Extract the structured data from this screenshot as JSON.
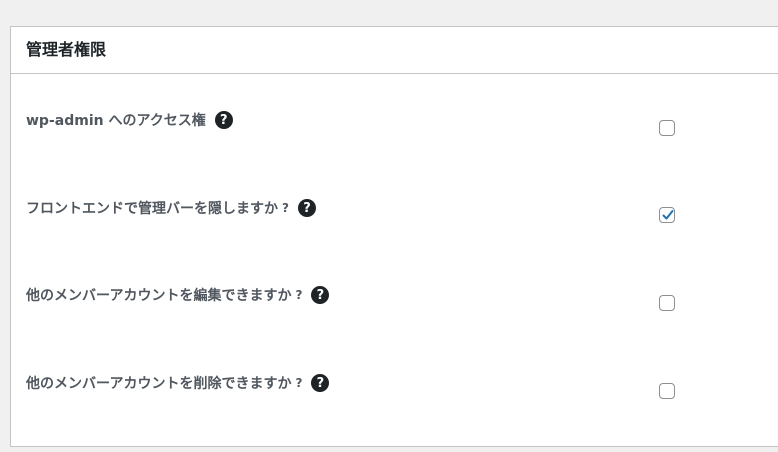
{
  "panel": {
    "title": "管理者権限"
  },
  "rows": [
    {
      "label": "wp-admin へのアクセス権",
      "question_mark": "",
      "help_icon": "?",
      "checked": false
    },
    {
      "label": "フロントエンドで管理バーを隠しますか",
      "question_mark": "?",
      "help_icon": "?",
      "checked": true
    },
    {
      "label": "他のメンバーアカウントを編集できますか",
      "question_mark": "?",
      "help_icon": "?",
      "checked": false
    },
    {
      "label": "他のメンバーアカウントを削除できますか",
      "question_mark": "?",
      "help_icon": "?",
      "checked": false
    }
  ],
  "colors": {
    "checkmark": "#2271b1",
    "help_icon_bg": "#1d2327"
  },
  "icons": {
    "help": "question-circle-icon",
    "check": "checkmark-icon"
  }
}
